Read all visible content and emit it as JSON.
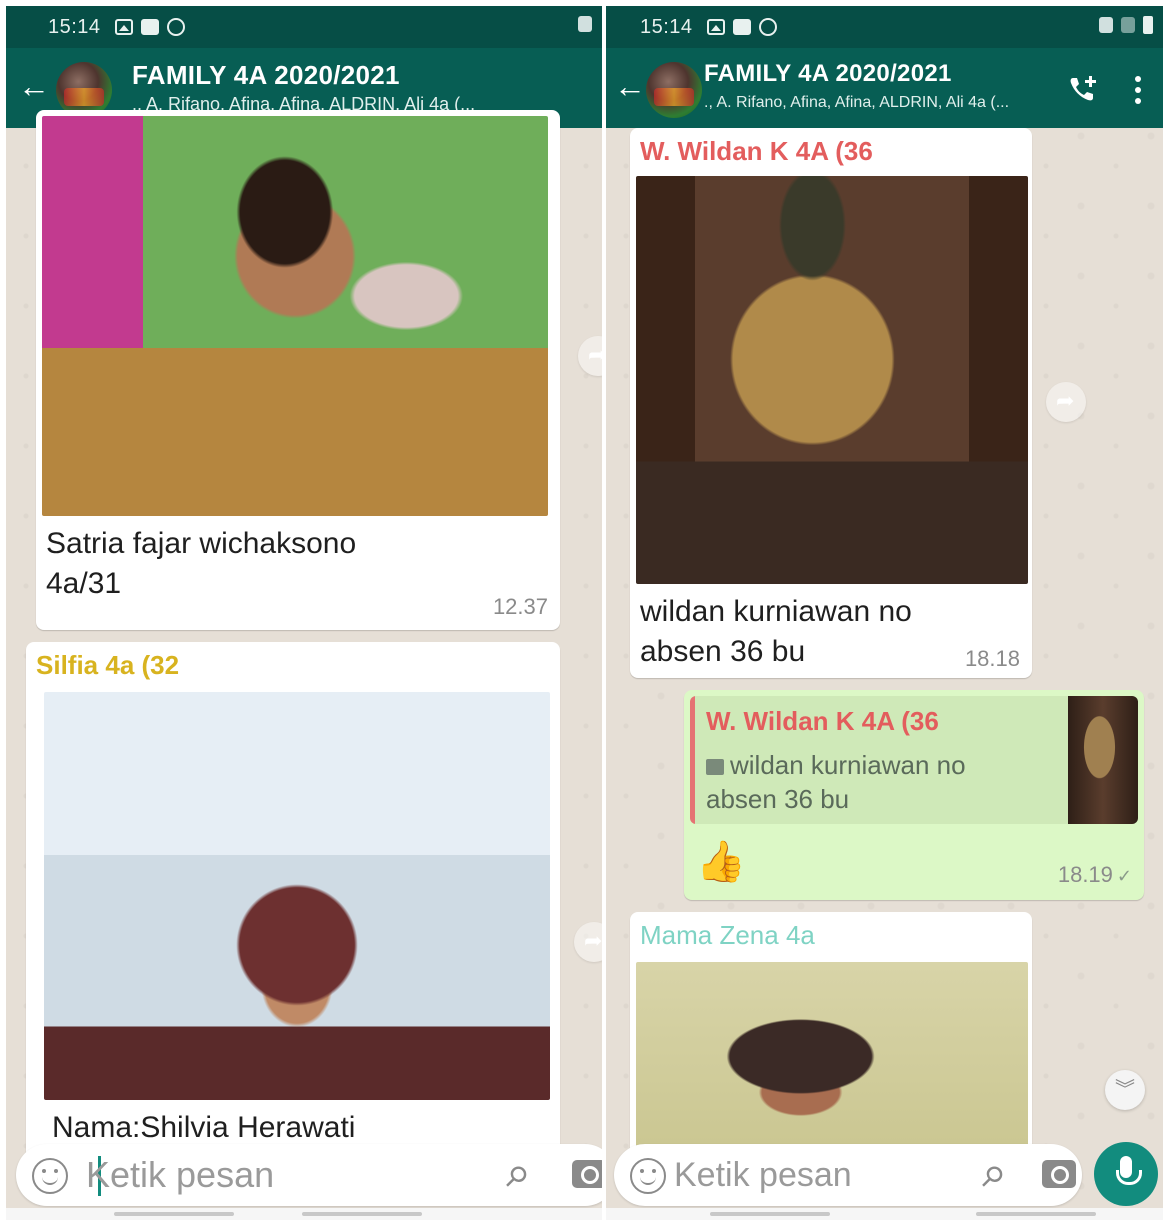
{
  "status": {
    "time": "15:14"
  },
  "chat": {
    "title": "FAMILY 4A 2020/2021",
    "subtitle": "., A. Rifano, Afina, Afina, ALDRIN, Ali 4a (..."
  },
  "colors": {
    "header": "#075e54",
    "statusbar": "#064e46",
    "accent": "#128c7e",
    "outgoing_bubble": "#dcf8c6"
  },
  "left_messages": [
    {
      "caption_line1": "Satria fajar wichaksono",
      "caption_line2": "4a/31",
      "time": "12.37"
    },
    {
      "sender": "Silfia 4a (32",
      "sender_color": "#d8b31f",
      "caption": "Nama:Shilvia Herawati"
    }
  ],
  "right_messages": [
    {
      "sender": "W. Wildan K 4A (36",
      "sender_color": "#e35d5d",
      "caption_line1": "wildan kurniawan no",
      "caption_line2": "absen 36 bu",
      "time": "18.18"
    },
    {
      "quote_sender": "W. Wildan K 4A (36",
      "quote_line1": "wildan kurniawan no",
      "quote_line2": "absen 36 bu",
      "emoji": "👍",
      "time": "18.19",
      "tick": "✓"
    },
    {
      "sender": "Mama Zena 4a",
      "sender_color": "#7fd3c4"
    }
  ],
  "input": {
    "placeholder": "Ketik pesan"
  },
  "icons": {
    "back": "arrow-left-icon",
    "call": "add-call-icon",
    "menu": "more-vert-icon",
    "attach": "paperclip-icon",
    "camera": "camera-icon",
    "mic": "mic-icon",
    "emoji": "emoji-icon",
    "forward": "forward-icon",
    "scroll": "double-chevron-down-icon"
  }
}
